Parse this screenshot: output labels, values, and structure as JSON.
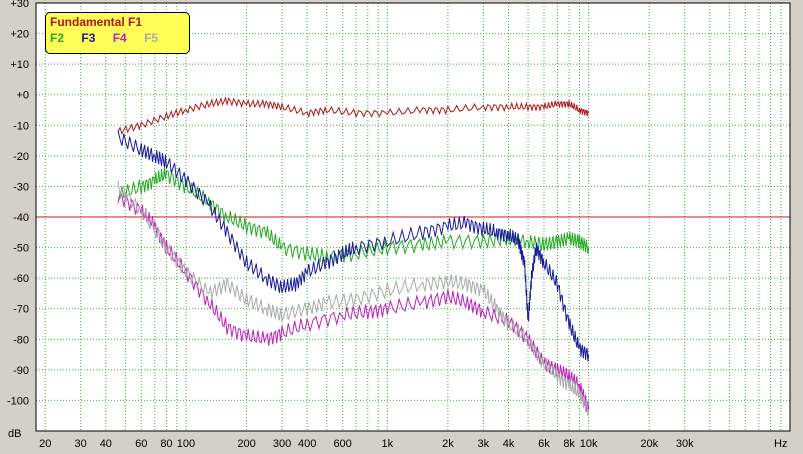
{
  "chart_data": {
    "type": "line",
    "xlabel": "Hz",
    "ylabel": "dB",
    "x_scale": "log",
    "xlim": [
      18,
      100000
    ],
    "ylim": [
      -110,
      30
    ],
    "grid": true,
    "legend_position": "top-left",
    "x_tick_labels": [
      {
        "v": 20,
        "t": "20"
      },
      {
        "v": 30,
        "t": "30"
      },
      {
        "v": 40,
        "t": "40"
      },
      {
        "v": 60,
        "t": "60"
      },
      {
        "v": 80,
        "t": "80"
      },
      {
        "v": 100,
        "t": "100"
      },
      {
        "v": 200,
        "t": "200"
      },
      {
        "v": 300,
        "t": "300"
      },
      {
        "v": 400,
        "t": "400"
      },
      {
        "v": 600,
        "t": "600"
      },
      {
        "v": 1000,
        "t": "1k"
      },
      {
        "v": 2000,
        "t": "2k"
      },
      {
        "v": 3000,
        "t": "3k"
      },
      {
        "v": 4000,
        "t": "4k"
      },
      {
        "v": 6000,
        "t": "6k"
      },
      {
        "v": 8000,
        "t": "8k"
      },
      {
        "v": 10000,
        "t": "10k"
      },
      {
        "v": 20000,
        "t": "20k"
      },
      {
        "v": 30000,
        "t": "30k"
      }
    ],
    "y_tick_labels": [
      {
        "v": 30,
        "t": "+30"
      },
      {
        "v": 20,
        "t": "+20"
      },
      {
        "v": 10,
        "t": "+10"
      },
      {
        "v": 0,
        "t": "+0"
      },
      {
        "v": -10,
        "t": "-10"
      },
      {
        "v": -20,
        "t": "-20"
      },
      {
        "v": -30,
        "t": "-30"
      },
      {
        "v": -40,
        "t": "-40"
      },
      {
        "v": -50,
        "t": "-50"
      },
      {
        "v": -60,
        "t": "-60"
      },
      {
        "v": -70,
        "t": "-70"
      },
      {
        "v": -80,
        "t": "-80"
      },
      {
        "v": -90,
        "t": "-90"
      },
      {
        "v": -100,
        "t": "-100"
      }
    ],
    "reference_line": {
      "y": -40,
      "color": "#bb2222"
    },
    "legend": {
      "title": "Fundamental F1",
      "items": [
        "F2",
        "F3",
        "F4",
        "F5"
      ]
    },
    "series": [
      {
        "name": "Fundamental F1",
        "color": "#b01818",
        "x": [
          46,
          60,
          80,
          100,
          130,
          160,
          200,
          250,
          300,
          400,
          500,
          700,
          1000,
          1500,
          2000,
          3000,
          4000,
          5000,
          6000,
          7000,
          8000,
          9000,
          10000
        ],
        "y": [
          -12,
          -10,
          -7,
          -5,
          -3,
          -2,
          -3,
          -3,
          -4,
          -6,
          -5,
          -6,
          -6,
          -5,
          -5,
          -4,
          -4,
          -4,
          -4,
          -3,
          -3,
          -5,
          -6
        ]
      },
      {
        "name": "F2",
        "color": "#22aa22",
        "x": [
          46,
          60,
          70,
          80,
          100,
          130,
          160,
          200,
          250,
          300,
          400,
          500,
          700,
          1000,
          1500,
          2000,
          3000,
          4000,
          5000,
          6000,
          7000,
          8000,
          9000,
          10000
        ],
        "y": [
          -33,
          -30,
          -28,
          -26,
          -30,
          -35,
          -40,
          -43,
          -45,
          -50,
          -52,
          -53,
          -52,
          -50,
          -49,
          -48,
          -48,
          -47,
          -48,
          -49,
          -48,
          -47,
          -48,
          -50
        ]
      },
      {
        "name": "F3",
        "color": "#1a1a99",
        "x": [
          46,
          60,
          70,
          80,
          100,
          130,
          160,
          200,
          250,
          300,
          350,
          400,
          500,
          600,
          700,
          1000,
          1500,
          2000,
          2500,
          3000,
          3500,
          4000,
          4500,
          4800,
          5000,
          5200,
          5500,
          6000,
          7000,
          8000,
          9000,
          10000
        ],
        "y": [
          -14,
          -18,
          -20,
          -22,
          -28,
          -36,
          -45,
          -55,
          -60,
          -63,
          -62,
          -58,
          -55,
          -52,
          -50,
          -48,
          -45,
          -43,
          -42,
          -44,
          -45,
          -46,
          -48,
          -55,
          -74,
          -60,
          -50,
          -55,
          -62,
          -75,
          -83,
          -85
        ]
      },
      {
        "name": "F4",
        "color": "#bb22bb",
        "x": [
          46,
          60,
          70,
          80,
          100,
          130,
          160,
          200,
          250,
          300,
          400,
          600,
          800,
          1000,
          1500,
          2000,
          2500,
          3000,
          4000,
          5000,
          6000,
          7000,
          8000,
          9000,
          10000
        ],
        "y": [
          -33,
          -38,
          -43,
          -50,
          -58,
          -68,
          -76,
          -79,
          -80,
          -78,
          -75,
          -72,
          -71,
          -70,
          -68,
          -66,
          -68,
          -71,
          -74,
          -80,
          -88,
          -90,
          -92,
          -95,
          -103
        ]
      },
      {
        "name": "F5",
        "color": "#aaaaaa",
        "x": [
          46,
          60,
          80,
          100,
          130,
          160,
          200,
          250,
          300,
          400,
          500,
          700,
          1000,
          1500,
          2000,
          2500,
          3000,
          3500,
          4000,
          5000,
          6000,
          7000,
          8000,
          9000,
          10000
        ],
        "y": [
          -30,
          -38,
          -50,
          -58,
          -65,
          -62,
          -67,
          -70,
          -72,
          -70,
          -68,
          -67,
          -64,
          -62,
          -61,
          -62,
          -64,
          -70,
          -75,
          -80,
          -88,
          -92,
          -95,
          -98,
          -103
        ]
      }
    ]
  }
}
